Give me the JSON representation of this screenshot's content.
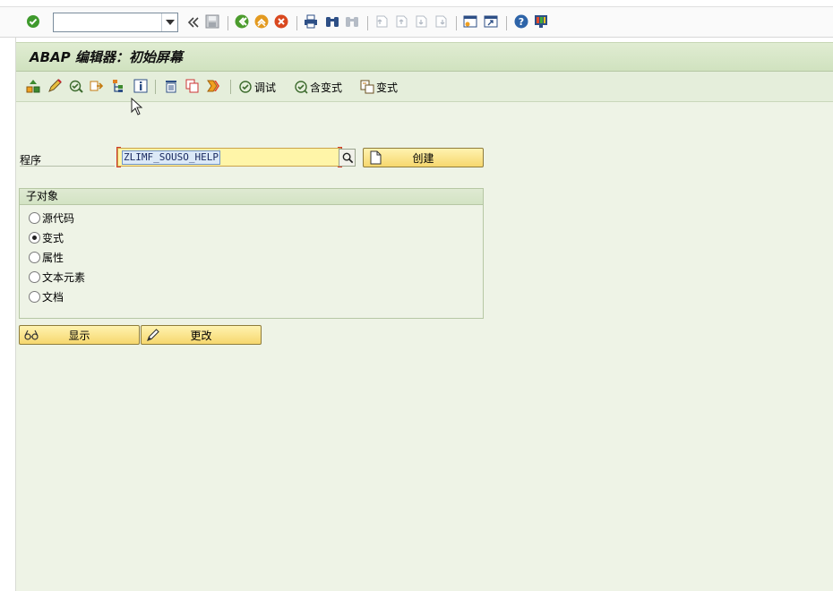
{
  "app": {
    "screen_title": "ABAP 编辑器：初始屏幕"
  },
  "command_field": {
    "value": ""
  },
  "app_toolbar": {
    "debug_label": "调试",
    "with_variant_label": "含变式",
    "variants_label": "变式"
  },
  "form": {
    "program_label": "程序",
    "program_value": "ZLIMF_SOUSO_HELP",
    "create_button": "创建"
  },
  "subobjects": {
    "group_title": "子对象",
    "options": [
      {
        "label": "源代码",
        "selected": false
      },
      {
        "label": "变式",
        "selected": true
      },
      {
        "label": "属性",
        "selected": false
      },
      {
        "label": "文本元素",
        "selected": false
      },
      {
        "label": "文档",
        "selected": false
      }
    ]
  },
  "actions": {
    "display_button": "显示",
    "change_button": "更改"
  },
  "icons": [
    "enter-icon",
    "save-icon",
    "back-icon",
    "exit-icon",
    "cancel-icon",
    "print-icon",
    "find-icon",
    "find-next-icon",
    "first-page-icon",
    "prev-page-icon",
    "next-page-icon",
    "last-page-icon",
    "new-session-icon",
    "shortcut-icon",
    "help-icon",
    "customize-icon"
  ]
}
